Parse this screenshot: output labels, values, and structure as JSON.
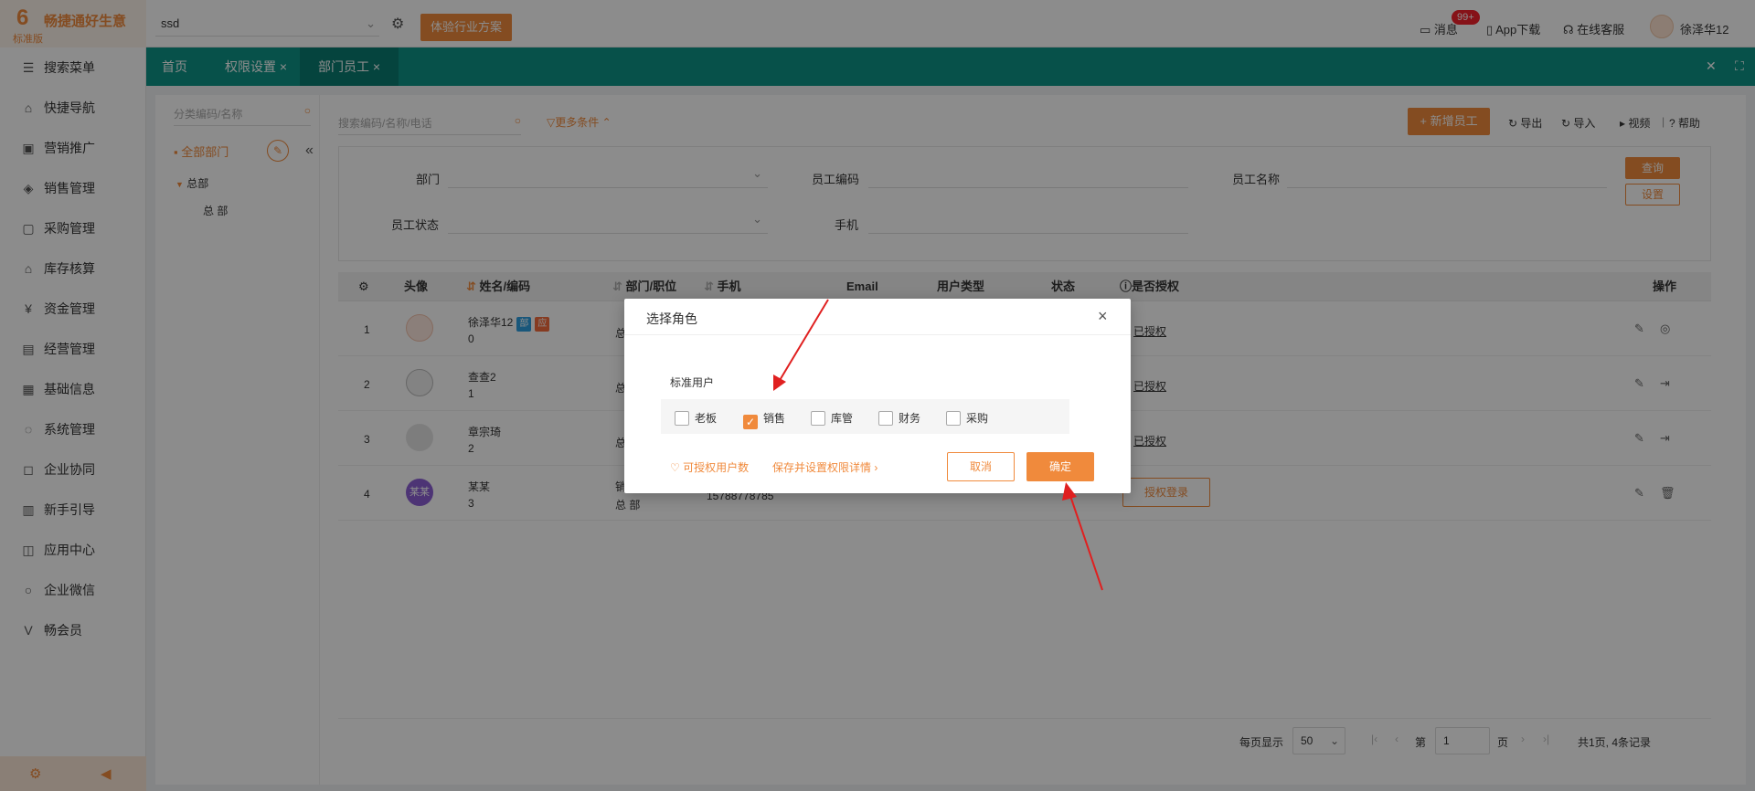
{
  "app": {
    "brand": "畅捷通好生意",
    "edition": "标准版",
    "logo_mark": "6"
  },
  "topbar": {
    "account": "ssd",
    "trial_label": "体验行业方案",
    "messages_label": "消息",
    "messages_badge": "99+",
    "app_download": "App下载",
    "online_service": "在线客服",
    "user_name": "徐泽华12"
  },
  "sidebar": {
    "items": [
      {
        "icon": "search-menu-icon",
        "glyph": "☰",
        "label": "搜索菜单"
      },
      {
        "icon": "home-icon",
        "glyph": "⌂",
        "label": "快捷导航"
      },
      {
        "icon": "gift-icon",
        "glyph": "▣",
        "label": "营销推广"
      },
      {
        "icon": "sales-icon",
        "glyph": "◈",
        "label": "销售管理"
      },
      {
        "icon": "bag-icon",
        "glyph": "▢",
        "label": "采购管理"
      },
      {
        "icon": "warehouse-icon",
        "glyph": "⌂",
        "label": "库存核算"
      },
      {
        "icon": "money-icon",
        "glyph": "¥",
        "label": "资金管理"
      },
      {
        "icon": "report-icon",
        "glyph": "▤",
        "label": "经营管理"
      },
      {
        "icon": "info-icon",
        "glyph": "▦",
        "label": "基础信息"
      },
      {
        "icon": "system-icon",
        "glyph": "◌",
        "label": "系统管理"
      },
      {
        "icon": "collab-icon",
        "glyph": "◻",
        "label": "企业协同"
      },
      {
        "icon": "guide-icon",
        "glyph": "▥",
        "label": "新手引导"
      },
      {
        "icon": "app-center-icon",
        "glyph": "◫",
        "label": "应用中心"
      },
      {
        "icon": "wechat-icon",
        "glyph": "○",
        "label": "企业微信"
      },
      {
        "icon": "vip-icon",
        "glyph": "V",
        "label": "畅会员"
      }
    ],
    "foot_settings": "⚙",
    "foot_collapse": "◀"
  },
  "tabs": [
    {
      "label": "首页"
    },
    {
      "label": "权限设置"
    },
    {
      "label": "部门员工"
    }
  ],
  "dept": {
    "search_placeholder": "分类编码/名称",
    "all_label": "全部部门",
    "tree_root": "总部",
    "tree_child": "总 部"
  },
  "main": {
    "search_placeholder": "搜索编码/名称/电话",
    "more_conditions": "更多条件",
    "add_button": "+ 新增员工",
    "export": "导出",
    "import": "导入",
    "video": "视频",
    "help": "帮助"
  },
  "filter": {
    "dept_label": "部门",
    "code_label": "员工编码",
    "name_label": "员工名称",
    "status_label": "员工状态",
    "phone_label": "手机",
    "query_button": "查询",
    "settings_button": "设置"
  },
  "table": {
    "headers": {
      "avatar": "头像",
      "name": "姓名/编码",
      "dept": "部门/职位",
      "phone": "手机",
      "email": "Email",
      "usertype": "用户类型",
      "status": "状态",
      "authorized": "是否授权",
      "actions": "操作"
    },
    "rows": [
      {
        "index": "1",
        "name": "徐泽华12",
        "code": "0",
        "tag1": "部",
        "tag2": "应",
        "dept": "总",
        "auth": "已授权"
      },
      {
        "index": "2",
        "name": "查查2",
        "code": "1",
        "dept": "总",
        "auth": "已授权"
      },
      {
        "index": "3",
        "name": "章宗琦",
        "code": "2",
        "dept": "总",
        "auth": "已授权"
      },
      {
        "index": "4",
        "name": "某某",
        "code": "3",
        "avatar_text": "某某",
        "dept": "销",
        "dept2": "总 部",
        "phone": "15788778785",
        "auth": "授权登录"
      }
    ]
  },
  "pager": {
    "per_page_label": "每页显示",
    "per_page": "50",
    "page_prefix": "第",
    "page": "1",
    "page_suffix": "页",
    "summary": "共1页, 4条记录"
  },
  "modal": {
    "title": "选择角色",
    "group_label": "标准用户",
    "roles": [
      {
        "label": "老板",
        "checked": false
      },
      {
        "label": "销售",
        "checked": true
      },
      {
        "label": "库管",
        "checked": false
      },
      {
        "label": "财务",
        "checked": false
      },
      {
        "label": "采购",
        "checked": false
      }
    ],
    "link_authorized_count": "可授权用户数",
    "link_save_and_set": "保存并设置权限详情",
    "cancel": "取消",
    "confirm": "确定"
  },
  "colors": {
    "accent": "#f08a3c",
    "tab_bar": "#0e9488",
    "annotation_arrow": "#e02020"
  }
}
